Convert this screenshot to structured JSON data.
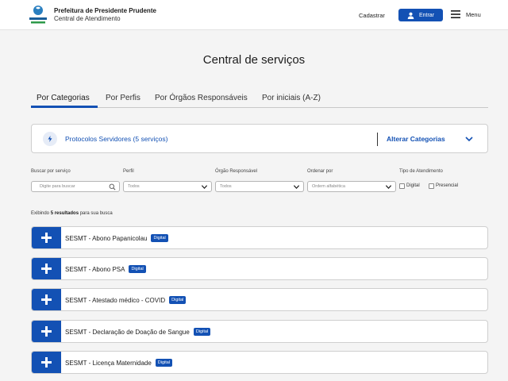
{
  "header": {
    "logo_text": "PRESIDENTE PRUDENTE",
    "org_title": "Prefeitura de Presidente Prudente",
    "org_subtitle": "Central de Atendimento",
    "cadastrar": "Cadastrar",
    "entrar": "Entrar",
    "menu": "Menu"
  },
  "page_title": "Central de serviços",
  "tabs": [
    {
      "label": "Por Categorias",
      "active": true
    },
    {
      "label": "Por Perfis"
    },
    {
      "label": "Por Órgãos Responsáveis"
    },
    {
      "label": "Por iniciais (A-Z)"
    }
  ],
  "category": {
    "name": "Protocolos Servidores",
    "count": "(5 serviços)",
    "alter": "Alterar Categorias"
  },
  "filters": {
    "search_label": "Buscar por serviço",
    "search_placeholder": "Digite para buscar",
    "perfil_label": "Perfil",
    "perfil_value": "Todos",
    "orgao_label": "Órgão Responsável",
    "orgao_value": "Todos",
    "ordenar_label": "Ordenar por",
    "ordenar_value": "Ordem alfabética",
    "tipo_label": "Tipo de Atendimento",
    "tipo_digital": "Digital",
    "tipo_presencial": "Presencial"
  },
  "results": {
    "prefix": "Exibindo",
    "count": "5 resultados",
    "suffix": "para sua busca"
  },
  "services": [
    {
      "name": "SESMT - Abono Papanicolau",
      "badge": "Digital"
    },
    {
      "name": "SESMT - Abono PSA",
      "badge": "Digital"
    },
    {
      "name": "SESMT - Atestado médico - COVID",
      "badge": "Digital"
    },
    {
      "name": "SESMT - Declaração de Doação de Sangue",
      "badge": "Digital"
    },
    {
      "name": "SESMT - Licença Maternidade",
      "badge": "Digital"
    }
  ],
  "colors": {
    "primary": "#1351b4",
    "background": "#f4f4f4"
  }
}
